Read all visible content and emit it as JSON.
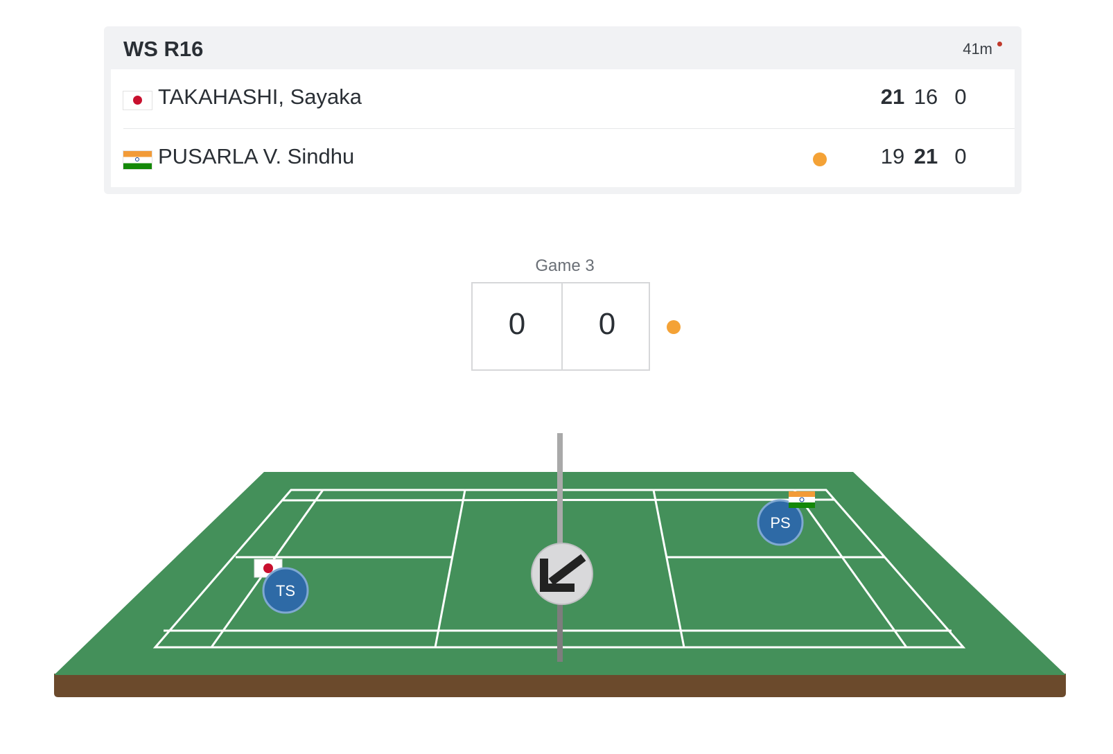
{
  "match": {
    "event": "WS R16",
    "duration": "41m"
  },
  "players": [
    {
      "name": "TAKAHASHI, Sayaka",
      "flag": "japan-flag",
      "initials": "TS",
      "scores": [
        "21",
        "16",
        "0"
      ],
      "serving": false
    },
    {
      "name": "PUSARLA V. Sindhu",
      "flag": "india-flag",
      "initials": "PS",
      "scores": [
        "19",
        "21",
        "0"
      ],
      "serving": true
    }
  ],
  "current_game": {
    "label": "Game 3",
    "left_score": "0",
    "right_score": "0"
  },
  "court": {
    "shuttle_direction_icon": "arrow-down-left-icon"
  },
  "colors": {
    "court_green": "#44905a",
    "court_edge": "#6b4a2c",
    "serve_indicator": "#f4a236",
    "player_badge": "#2e6aa6",
    "live_indicator": "#c0392b"
  }
}
